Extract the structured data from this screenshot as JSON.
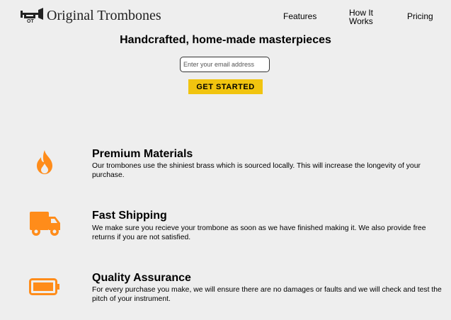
{
  "header": {
    "brand": "Original Trombones",
    "nav": {
      "features": "Features",
      "how_it_works": "How It Works",
      "pricing": "Pricing"
    }
  },
  "hero": {
    "title": "Handcrafted, home-made masterpieces",
    "email_placeholder": "Enter your email address",
    "cta_label": "GET STARTED"
  },
  "features": [
    {
      "icon": "fire-icon",
      "title": "Premium Materials",
      "description": "Our trombones use the shiniest brass which is sourced locally. This will increase the longevity of your purchase."
    },
    {
      "icon": "truck-icon",
      "title": "Fast Shipping",
      "description": "We make sure you recieve your trombone as soon as we have finished making it. We also provide free returns if you are not satisfied."
    },
    {
      "icon": "battery-icon",
      "title": "Quality Assurance",
      "description": "For every purchase you make, we will ensure there are no damages or faults and we will check and test the pitch of your instrument."
    }
  ],
  "colors": {
    "background": "#eeeeee",
    "accent": "#f1c40f",
    "icon": "#ff8c1a"
  }
}
